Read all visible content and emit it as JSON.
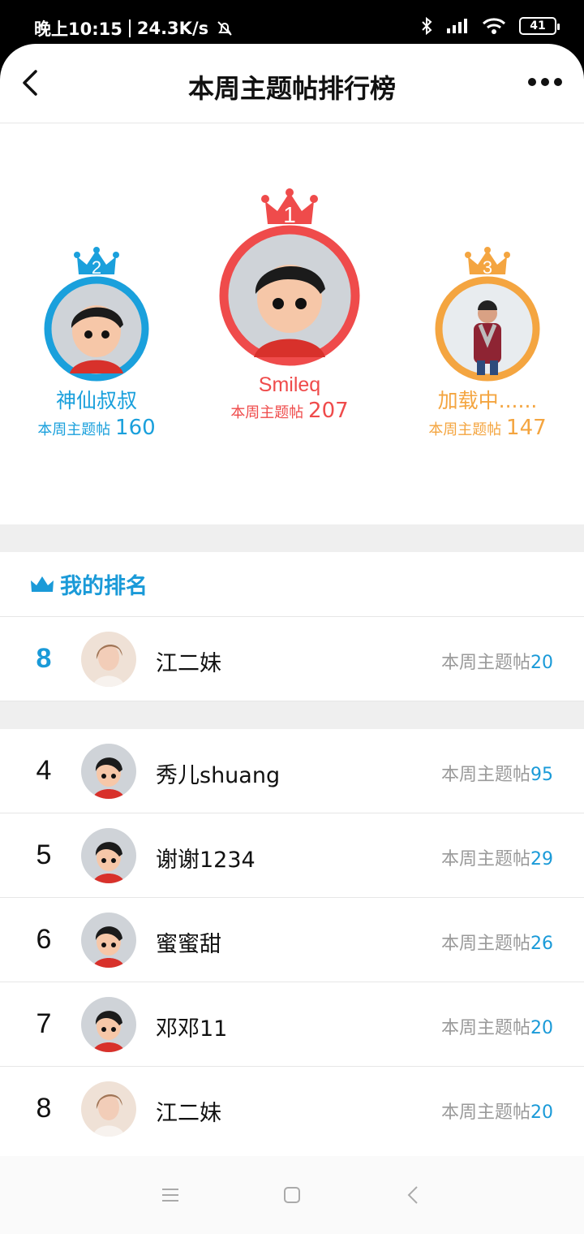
{
  "status_bar": {
    "time": "晚上10:15",
    "speed": "24.3K/s",
    "battery": "41"
  },
  "header": {
    "title": "本周主题帖排行榜"
  },
  "podium": [
    {
      "rank": "1",
      "name": "Smileq",
      "label": "本周主题帖",
      "count": "207",
      "color": "#ef4b4b"
    },
    {
      "rank": "2",
      "name": "神仙叔叔",
      "label": "本周主题帖",
      "count": "160",
      "color": "#1aa0dc"
    },
    {
      "rank": "3",
      "name": "加载中......",
      "label": "本周主题帖",
      "count": "147",
      "color": "#f4a540"
    }
  ],
  "my_rank": {
    "title": "我的排名",
    "rank": "8",
    "name": "江二妹",
    "label": "本周主题帖",
    "count": "20"
  },
  "list": [
    {
      "rank": "4",
      "name": "秀儿shuang",
      "label": "本周主题帖",
      "count": "95",
      "avatar": "cartoon"
    },
    {
      "rank": "5",
      "name": "谢谢1234",
      "label": "本周主题帖",
      "count": "29",
      "avatar": "cartoon"
    },
    {
      "rank": "6",
      "name": "蜜蜜甜",
      "label": "本周主题帖",
      "count": "26",
      "avatar": "cartoon"
    },
    {
      "rank": "7",
      "name": "邓邓11",
      "label": "本周主题帖",
      "count": "20",
      "avatar": "cartoon"
    },
    {
      "rank": "8",
      "name": "江二妹",
      "label": "本周主题帖",
      "count": "20",
      "avatar": "photo-woman"
    }
  ]
}
